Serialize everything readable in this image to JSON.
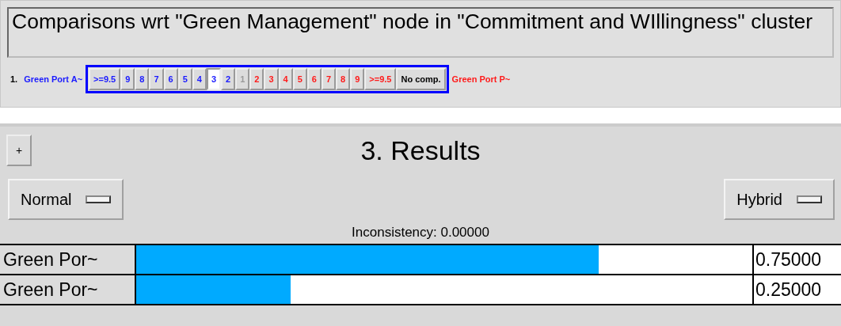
{
  "comparison": {
    "title": "Comparisons wrt \"Green Management\" node in \"Commitment and WIllingness\" cluster",
    "number": "1.",
    "left_label": "Green Port A~",
    "right_label": "Green Port P~",
    "scale": [
      {
        "label": ">=9.5",
        "kind": "left",
        "selected": false
      },
      {
        "label": "9",
        "kind": "left",
        "selected": false
      },
      {
        "label": "8",
        "kind": "left",
        "selected": false
      },
      {
        "label": "7",
        "kind": "left",
        "selected": false
      },
      {
        "label": "6",
        "kind": "left",
        "selected": false
      },
      {
        "label": "5",
        "kind": "left",
        "selected": false
      },
      {
        "label": "4",
        "kind": "left",
        "selected": false
      },
      {
        "label": "3",
        "kind": "left",
        "selected": true
      },
      {
        "label": "2",
        "kind": "left",
        "selected": false
      },
      {
        "label": "1",
        "kind": "equal",
        "selected": false
      },
      {
        "label": "2",
        "kind": "right",
        "selected": false
      },
      {
        "label": "3",
        "kind": "right",
        "selected": false
      },
      {
        "label": "4",
        "kind": "right",
        "selected": false
      },
      {
        "label": "5",
        "kind": "right",
        "selected": false
      },
      {
        "label": "6",
        "kind": "right",
        "selected": false
      },
      {
        "label": "7",
        "kind": "right",
        "selected": false
      },
      {
        "label": "8",
        "kind": "right",
        "selected": false
      },
      {
        "label": "9",
        "kind": "right",
        "selected": false
      },
      {
        "label": ">=9.5",
        "kind": "right",
        "selected": false
      },
      {
        "label": "No comp.",
        "kind": "none",
        "selected": false
      }
    ]
  },
  "results": {
    "expand_button": "+",
    "title": "3. Results",
    "mode_menu": "Normal",
    "type_menu": "Hybrid",
    "inconsistency": "Inconsistency: 0.00000",
    "rows": [
      {
        "name": "Green Por~",
        "level": 0.75,
        "value": "0.75000"
      },
      {
        "name": "Green Por~",
        "level": 0.25,
        "value": "0.25000"
      }
    ]
  }
}
